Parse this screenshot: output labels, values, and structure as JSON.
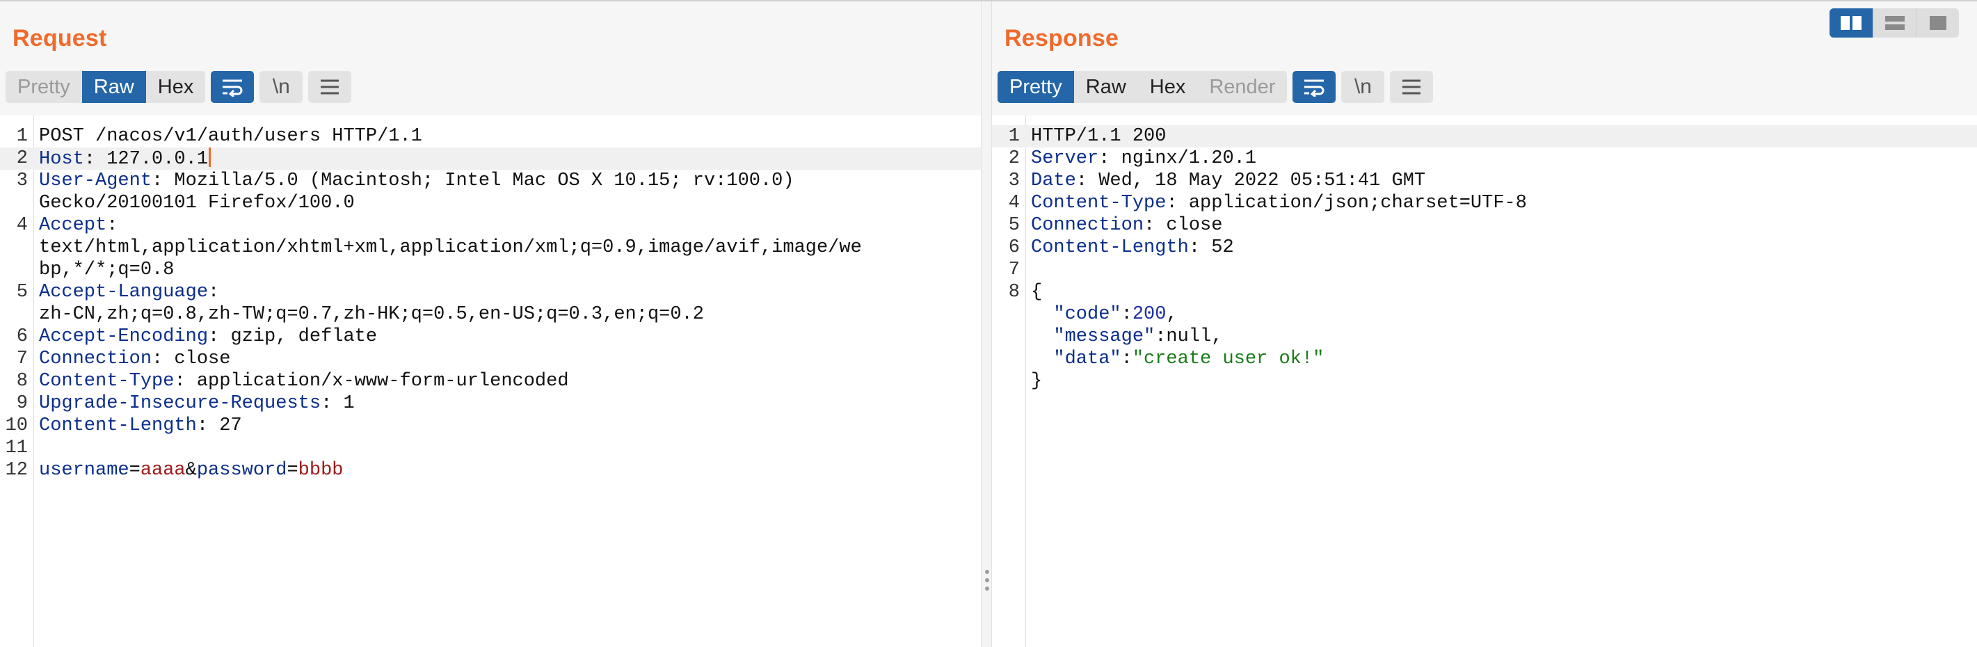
{
  "colors": {
    "accent": "#f06a2c",
    "active": "#2466a8",
    "key": "#0b2e8c",
    "param_value": "#9e1a1a",
    "json_string": "#1a7a1a"
  },
  "layout_switch": [
    {
      "name": "side-by-side-layout-icon",
      "active": true
    },
    {
      "name": "stacked-layout-icon",
      "active": false
    },
    {
      "name": "single-pane-layout-icon",
      "active": false
    }
  ],
  "request": {
    "title": "Request",
    "view_tabs": [
      {
        "label": "Pretty",
        "state": "inactive"
      },
      {
        "label": "Raw",
        "state": "active"
      },
      {
        "label": "Hex",
        "state": "normal"
      }
    ],
    "tools": {
      "wrap_icon": "wrap-lines-icon",
      "newline_label": "\\n",
      "menu_icon": "hamburger-menu-icon"
    },
    "lines": [
      {
        "n": "1",
        "text": "POST /nacos/v1/auth/users HTTP/1.1"
      },
      {
        "n": "2",
        "key": "Host",
        "value": ": 127.0.0.1"
      },
      {
        "n": "3",
        "key": "User-Agent",
        "value": ": Mozilla/5.0 (Macintosh; Intel Mac OS X 10.15; rv:100.0)"
      },
      {
        "n": "",
        "text": "Gecko/20100101 Firefox/100.0"
      },
      {
        "n": "4",
        "key": "Accept",
        "value": ":"
      },
      {
        "n": "",
        "text": "text/html,application/xhtml+xml,application/xml;q=0.9,image/avif,image/we"
      },
      {
        "n": "",
        "text": "bp,*/*;q=0.8"
      },
      {
        "n": "5",
        "key": "Accept-Language",
        "value": ":"
      },
      {
        "n": "",
        "text": "zh-CN,zh;q=0.8,zh-TW;q=0.7,zh-HK;q=0.5,en-US;q=0.3,en;q=0.2"
      },
      {
        "n": "6",
        "key": "Accept-Encoding",
        "value": ": gzip, deflate"
      },
      {
        "n": "7",
        "key": "Connection",
        "value": ": close"
      },
      {
        "n": "8",
        "key": "Content-Type",
        "value": ": application/x-www-form-urlencoded"
      },
      {
        "n": "9",
        "key": "Upgrade-Insecure-Requests",
        "value": ": 1"
      },
      {
        "n": "10",
        "key": "Content-Length",
        "value": ": 27"
      },
      {
        "n": "11",
        "text": ""
      },
      {
        "n": "12",
        "body": [
          {
            "t": "key",
            "v": "username"
          },
          {
            "t": "plain",
            "v": "="
          },
          {
            "t": "str",
            "v": "aaaa"
          },
          {
            "t": "plain",
            "v": "&"
          },
          {
            "t": "key",
            "v": "password"
          },
          {
            "t": "plain",
            "v": "="
          },
          {
            "t": "str",
            "v": "bbbb"
          }
        ]
      }
    ]
  },
  "response": {
    "title": "Response",
    "view_tabs": [
      {
        "label": "Pretty",
        "state": "active"
      },
      {
        "label": "Raw",
        "state": "normal"
      },
      {
        "label": "Hex",
        "state": "normal"
      },
      {
        "label": "Render",
        "state": "inactive"
      }
    ],
    "tools": {
      "wrap_icon": "wrap-lines-icon",
      "newline_label": "\\n",
      "menu_icon": "hamburger-menu-icon"
    },
    "lines": [
      {
        "n": "1",
        "text": "HTTP/1.1 200"
      },
      {
        "n": "2",
        "key": "Server",
        "value": ": nginx/1.20.1"
      },
      {
        "n": "3",
        "key": "Date",
        "value": ": Wed, 18 May 2022 05:51:41 GMT"
      },
      {
        "n": "4",
        "key": "Content-Type",
        "value": ": application/json;charset=UTF-8"
      },
      {
        "n": "5",
        "key": "Connection",
        "value": ": close"
      },
      {
        "n": "6",
        "key": "Content-Length",
        "value": ": 52"
      },
      {
        "n": "7",
        "text": ""
      },
      {
        "n": "8",
        "text": "{"
      },
      {
        "n": "",
        "body": [
          {
            "t": "plain",
            "v": "  "
          },
          {
            "t": "key",
            "v": "\"code\""
          },
          {
            "t": "plain",
            "v": ":"
          },
          {
            "t": "num",
            "v": "200"
          },
          {
            "t": "plain",
            "v": ","
          }
        ]
      },
      {
        "n": "",
        "body": [
          {
            "t": "plain",
            "v": "  "
          },
          {
            "t": "key",
            "v": "\"message\""
          },
          {
            "t": "plain",
            "v": ":null,"
          }
        ]
      },
      {
        "n": "",
        "body": [
          {
            "t": "plain",
            "v": "  "
          },
          {
            "t": "key",
            "v": "\"data\""
          },
          {
            "t": "plain",
            "v": ":"
          },
          {
            "t": "jstr",
            "v": "\"create user ok!\""
          }
        ]
      },
      {
        "n": "",
        "text": "}"
      }
    ]
  }
}
